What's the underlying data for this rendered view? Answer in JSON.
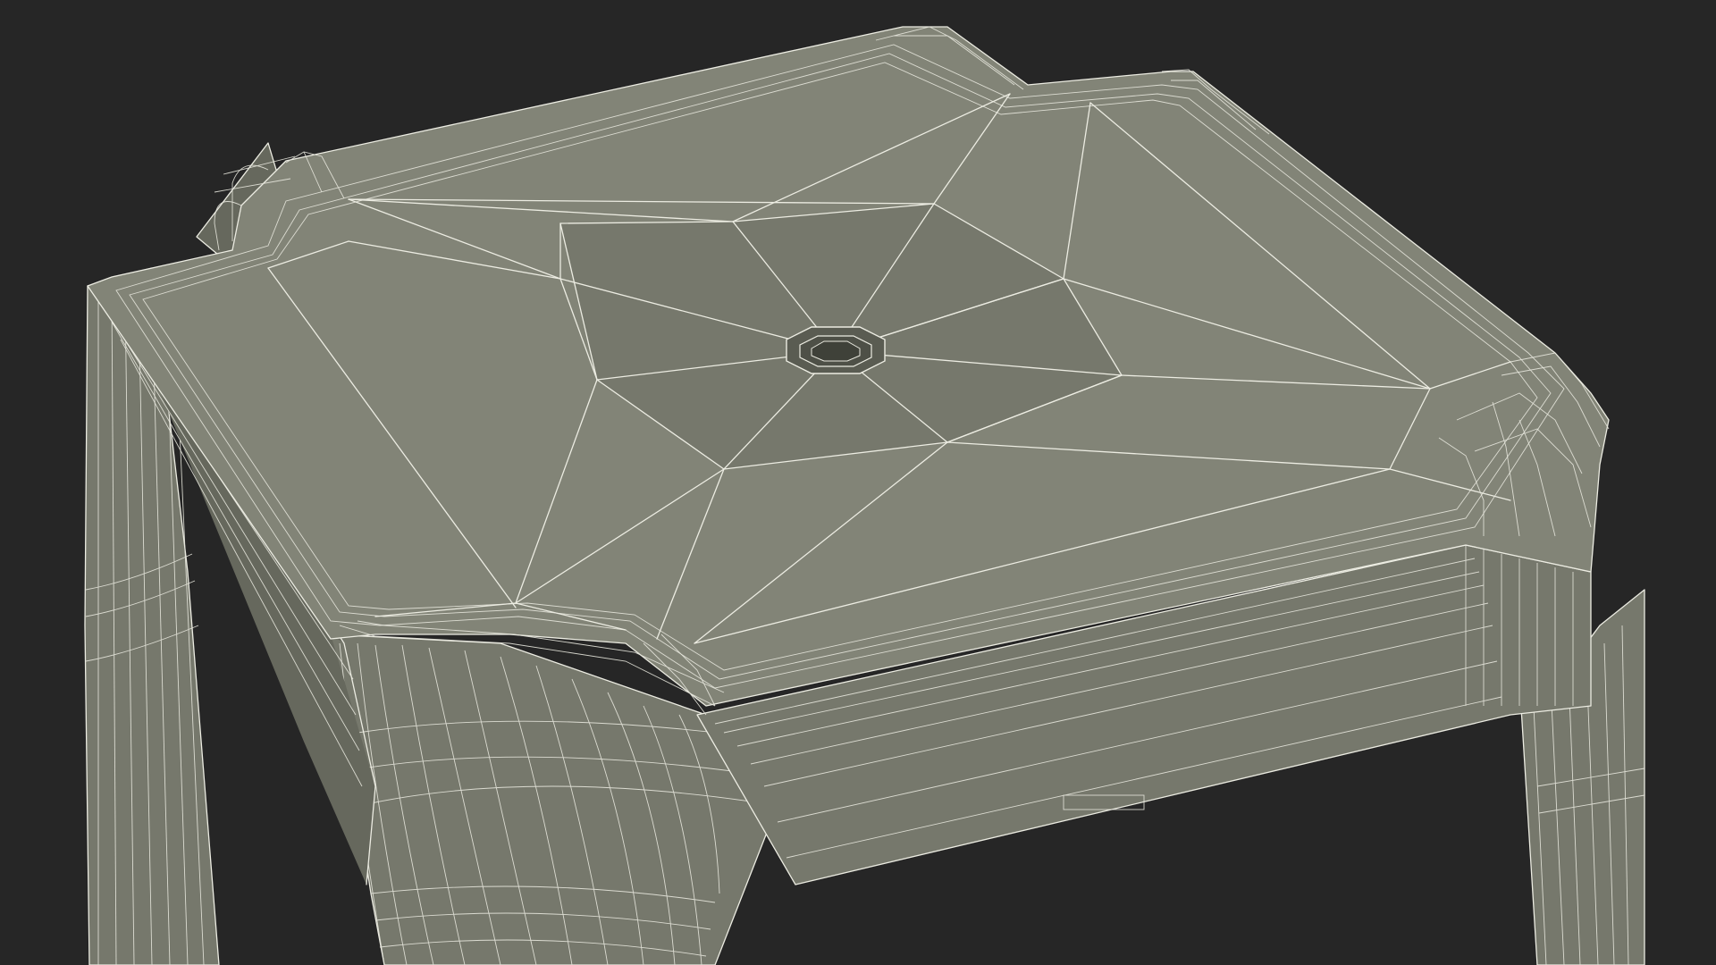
{
  "scene": {
    "background_color": "#262626",
    "mesh_fill_color": "#76786c",
    "wire_color": "#ecece2",
    "subject": "wireframe-table-model"
  }
}
